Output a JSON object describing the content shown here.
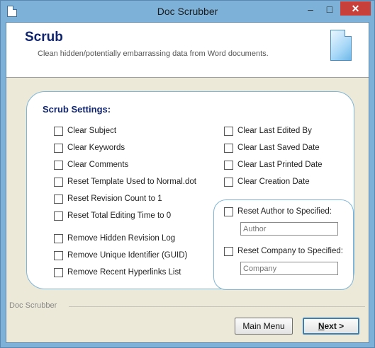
{
  "window": {
    "title": "Doc Scrubber",
    "controls": {
      "minimize": "–",
      "maximize": "□",
      "close": "✕"
    }
  },
  "header": {
    "title": "Scrub",
    "subtitle": "Clean hidden/potentially embarrassing data from Word documents."
  },
  "settings": {
    "title": "Scrub Settings:",
    "left": [
      {
        "label": "Clear Subject",
        "checked": false
      },
      {
        "label": "Clear Keywords",
        "checked": false
      },
      {
        "label": "Clear Comments",
        "checked": false
      },
      {
        "label": "Reset Template Used to Normal.dot",
        "checked": false
      },
      {
        "label": "Reset Revision Count to 1",
        "checked": false
      },
      {
        "label": "Reset Total Editing Time to 0",
        "checked": false
      },
      {
        "label": "Remove Hidden Revision Log",
        "checked": false
      },
      {
        "label": "Remove Unique Identifier (GUID)",
        "checked": false
      },
      {
        "label": "Remove Recent Hyperlinks List",
        "checked": false
      }
    ],
    "right": [
      {
        "label": "Clear Last Edited By",
        "checked": false
      },
      {
        "label": "Clear Last Saved Date",
        "checked": false
      },
      {
        "label": "Clear Last Printed Date",
        "checked": false
      },
      {
        "label": "Clear Creation Date",
        "checked": false
      }
    ],
    "reset_author": {
      "label": "Reset Author to Specified:",
      "checked": false,
      "placeholder": "Author",
      "value": ""
    },
    "reset_company": {
      "label": "Reset Company to Specified:",
      "checked": false,
      "placeholder": "Company",
      "value": ""
    }
  },
  "footer": {
    "group_label": "Doc Scrubber",
    "main_menu": "Main Menu",
    "next_char": "N",
    "next_rest": "ext >"
  },
  "colors": {
    "title_bar": "#7db1d8",
    "close_button": "#c7413a",
    "heading_text": "#10256e",
    "group_border": "#7fb6d8"
  }
}
